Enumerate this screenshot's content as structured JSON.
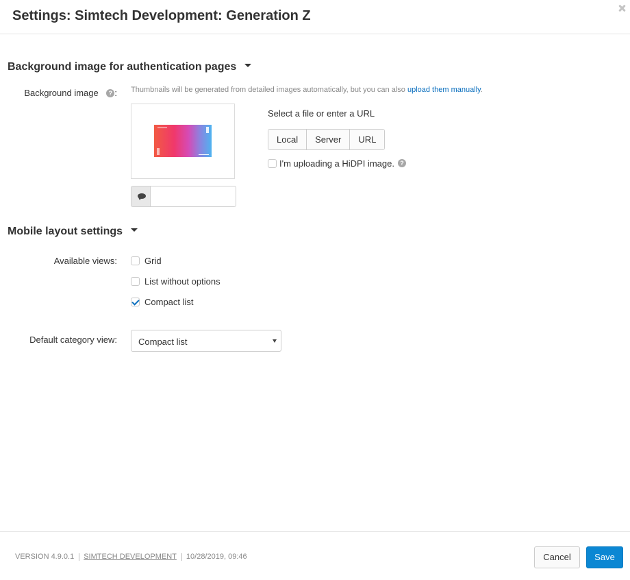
{
  "dialog": {
    "title": "Settings: Simtech Development: Generation Z"
  },
  "background_section": {
    "title": "Background image for authentication pages",
    "label": "Background image",
    "help_icon": "?",
    "colon": ":",
    "hint_prefix": "Thumbnails will be generated from detailed images automatically, but you can also",
    "hint_link": "upload them manually",
    "hint_suffix": ".",
    "alt_text_value": "",
    "file_prompt": "Select a file or enter a URL",
    "source_buttons": [
      "Local",
      "Server",
      "URL"
    ],
    "hidpi_label": "I'm uploading a HiDPI image.",
    "hidpi_checked": false,
    "hidpi_help": "?"
  },
  "mobile_section": {
    "title": "Mobile layout settings",
    "available_views_label": "Available views:",
    "views": [
      {
        "label": "Grid",
        "checked": false
      },
      {
        "label": "List without options",
        "checked": false
      },
      {
        "label": "Compact list",
        "checked": true
      }
    ],
    "default_view_label": "Default category view:",
    "default_view_value": "Compact list"
  },
  "footer": {
    "version": "VERSION 4.9.0.1",
    "vendor": "SIMTECH DEVELOPMENT",
    "datetime": "10/28/2019, 09:46",
    "cancel_label": "Cancel",
    "save_label": "Save"
  },
  "colors": {
    "accent": "#0b87d3",
    "link": "#0b6fbe",
    "text": "#333333",
    "muted": "#888888"
  }
}
